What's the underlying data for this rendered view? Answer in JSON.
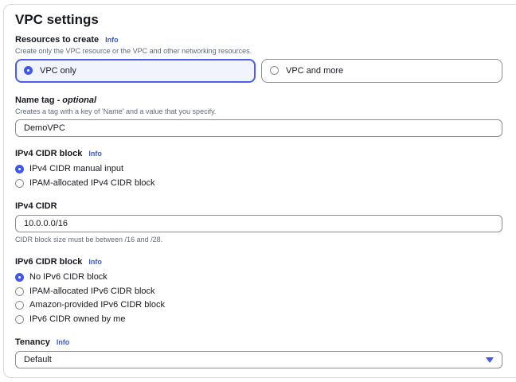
{
  "section": {
    "title": "VPC settings"
  },
  "resources": {
    "label": "Resources to create",
    "info": "Info",
    "description": "Create only the VPC resource or the VPC and other networking resources.",
    "options": [
      {
        "label": "VPC only",
        "selected": true
      },
      {
        "label": "VPC and more",
        "selected": false
      }
    ]
  },
  "name_tag": {
    "label": "Name tag - ",
    "optional": "optional",
    "description": "Creates a tag with a key of 'Name' and a value that you specify.",
    "value": "DemoVPC"
  },
  "ipv4_block": {
    "label": "IPv4 CIDR block",
    "info": "Info",
    "options": [
      {
        "label": "IPv4 CIDR manual input",
        "selected": true
      },
      {
        "label": "IPAM-allocated IPv4 CIDR block",
        "selected": false
      }
    ]
  },
  "ipv4_cidr": {
    "label": "IPv4 CIDR",
    "value": "10.0.0.0/16",
    "hint": "CIDR block size must be between /16 and /28."
  },
  "ipv6_block": {
    "label": "IPv6 CIDR block",
    "info": "Info",
    "options": [
      {
        "label": "No IPv6 CIDR block",
        "selected": true
      },
      {
        "label": "IPAM-allocated IPv6 CIDR block",
        "selected": false
      },
      {
        "label": "Amazon-provided IPv6 CIDR block",
        "selected": false
      },
      {
        "label": "IPv6 CIDR owned by me",
        "selected": false
      }
    ]
  },
  "tenancy": {
    "label": "Tenancy",
    "info": "Info",
    "value": "Default",
    "caret_icon": "caret-down-icon"
  },
  "colors": {
    "accent": "#3f58e8",
    "info_link": "#3f58c4",
    "border": "#8c8c94"
  }
}
